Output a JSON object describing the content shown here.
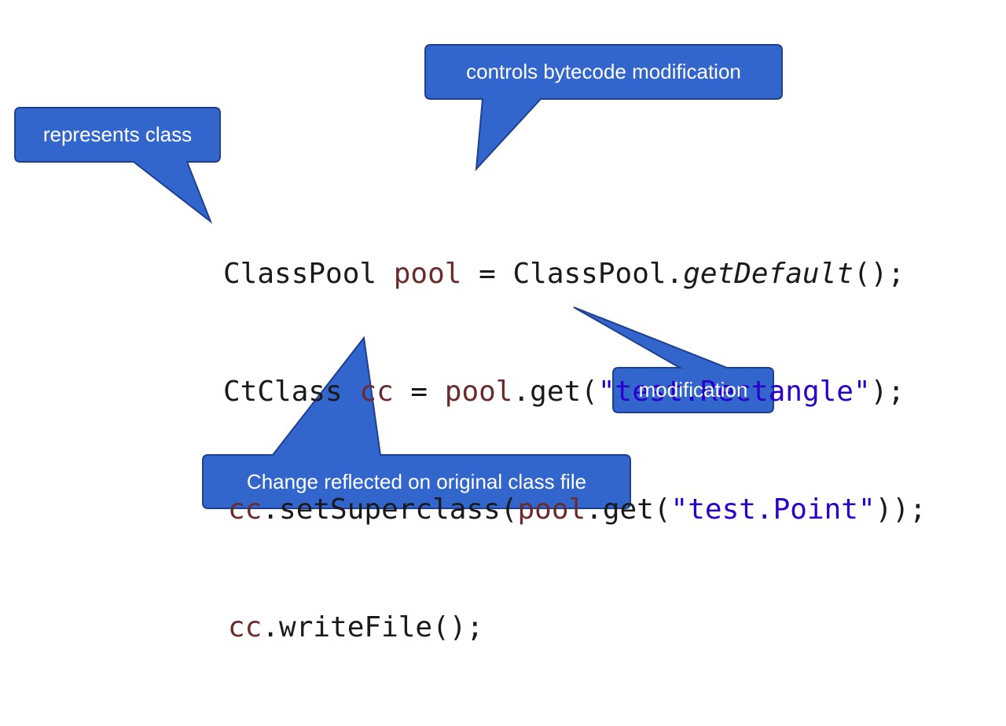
{
  "callouts": {
    "bytecode": "controls bytecode modification",
    "represents": "represents class",
    "modification": "modification",
    "change": "Change reflected on original class file"
  },
  "code": {
    "l1": {
      "a": "ClassPool ",
      "b": "pool",
      "c": " = ClassPool.",
      "d": "getDefault",
      "e": "();"
    },
    "l2": {
      "a": "CtClass ",
      "b": "cc",
      "c": " = ",
      "d": "pool",
      "e": ".get(",
      "f": "\"test.Rectangle\"",
      "g": ");"
    },
    "l3": {
      "a": "cc",
      "b": ".setSuperclass(",
      "c": "pool",
      "d": ".get(",
      "e": "\"test.Point\"",
      "f": "));"
    },
    "l4": {
      "a": "cc",
      "b": ".writeFile();"
    }
  },
  "colors": {
    "callout_fill": "#3366cc",
    "callout_stroke": "#1f3f8f",
    "callout_text": "#ffffff",
    "code_text": "#1a1a1a",
    "variable": "#6b2b2b",
    "string": "#2a00cc"
  }
}
